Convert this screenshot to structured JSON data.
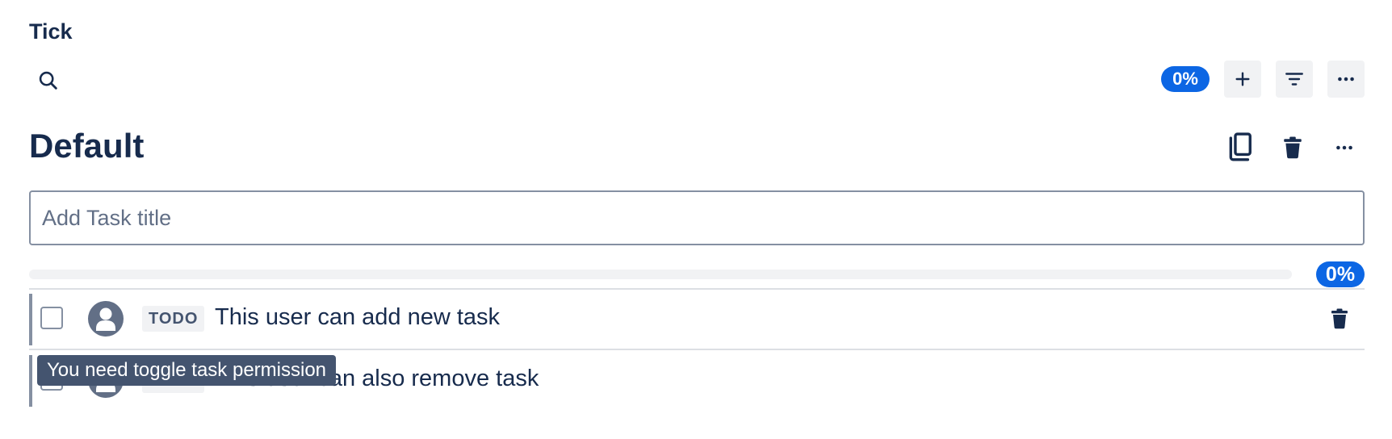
{
  "app": {
    "name": "Tick"
  },
  "toolbar": {
    "search_icon": "search-icon",
    "progress_label": "0%",
    "progress_value": 0,
    "add_icon": "plus-icon",
    "filter_icon": "filter-icon",
    "more_icon": "more-horizontal-icon"
  },
  "list": {
    "title": "Default",
    "copy_icon": "copy-icon",
    "delete_icon": "trash-icon",
    "more_icon": "more-horizontal-icon",
    "input_placeholder": "Add Task title",
    "input_value": "",
    "progress_label": "0%",
    "progress_value": 0
  },
  "tasks": [
    {
      "status": "TODO",
      "title": "This user can add new task",
      "checked": false,
      "avatar_icon": "user-avatar-icon",
      "delete_icon": "trash-icon"
    },
    {
      "status": "TODO",
      "title": "This user can also remove task",
      "checked": false,
      "avatar_icon": "user-avatar-icon"
    }
  ],
  "tooltip": {
    "text": "You need toggle task permission"
  },
  "colors": {
    "accent": "#0c66e4",
    "text": "#172b4d",
    "border": "#8590a2",
    "subtle_bg": "#f1f2f4",
    "tooltip_bg": "#44546f"
  }
}
